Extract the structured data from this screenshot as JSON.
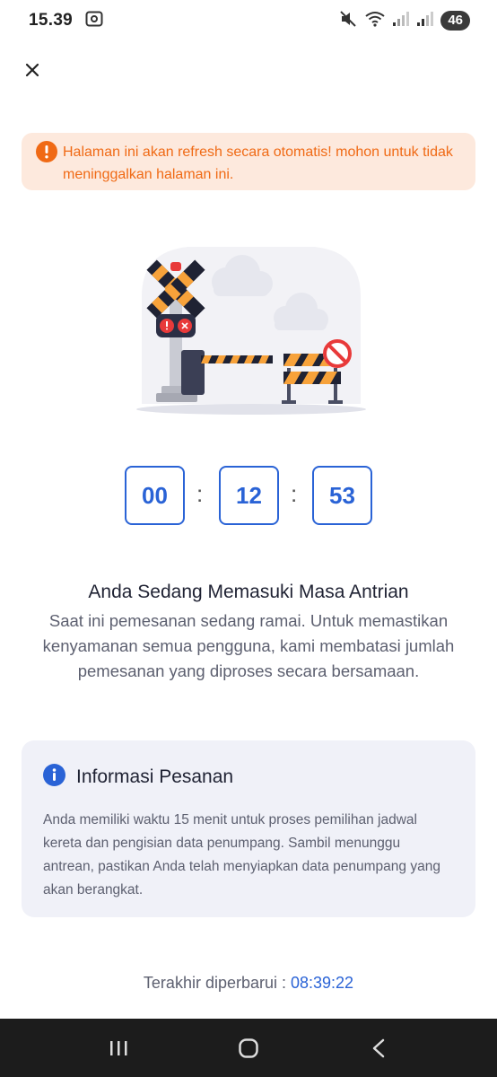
{
  "status_bar": {
    "time": "15.39",
    "battery": "46"
  },
  "alert": {
    "message": "Halaman ini akan refresh secara otomatis! mohon untuk tidak meninggalkan halaman ini."
  },
  "timer": {
    "hours": "00",
    "minutes": "12",
    "seconds": "53",
    "separator": ":"
  },
  "queue": {
    "title": "Anda Sedang Memasuki Masa Antrian",
    "description": "Saat ini pemesanan sedang ramai. Untuk memastikan kenyamanan semua pengguna, kami membatasi jumlah pemesanan yang diproses secara bersamaan."
  },
  "info": {
    "title": "Informasi Pesanan",
    "body": "Anda memiliki waktu 15 menit untuk proses pemilihan jadwal kereta dan pengisian data penumpang. Sambil menunggu antrean, pastikan Anda telah menyiapkan data penumpang yang akan berangkat."
  },
  "updated": {
    "label": "Terakhir diperbarui : ",
    "value": "08:39:22"
  },
  "colors": {
    "accent_blue": "#2a63d6",
    "alert_orange": "#f06a15",
    "alert_bg": "#fde9dd",
    "card_bg": "#f0f1f8"
  },
  "icons": {
    "close": "close-icon",
    "alert": "alert-icon",
    "info": "info-icon"
  }
}
